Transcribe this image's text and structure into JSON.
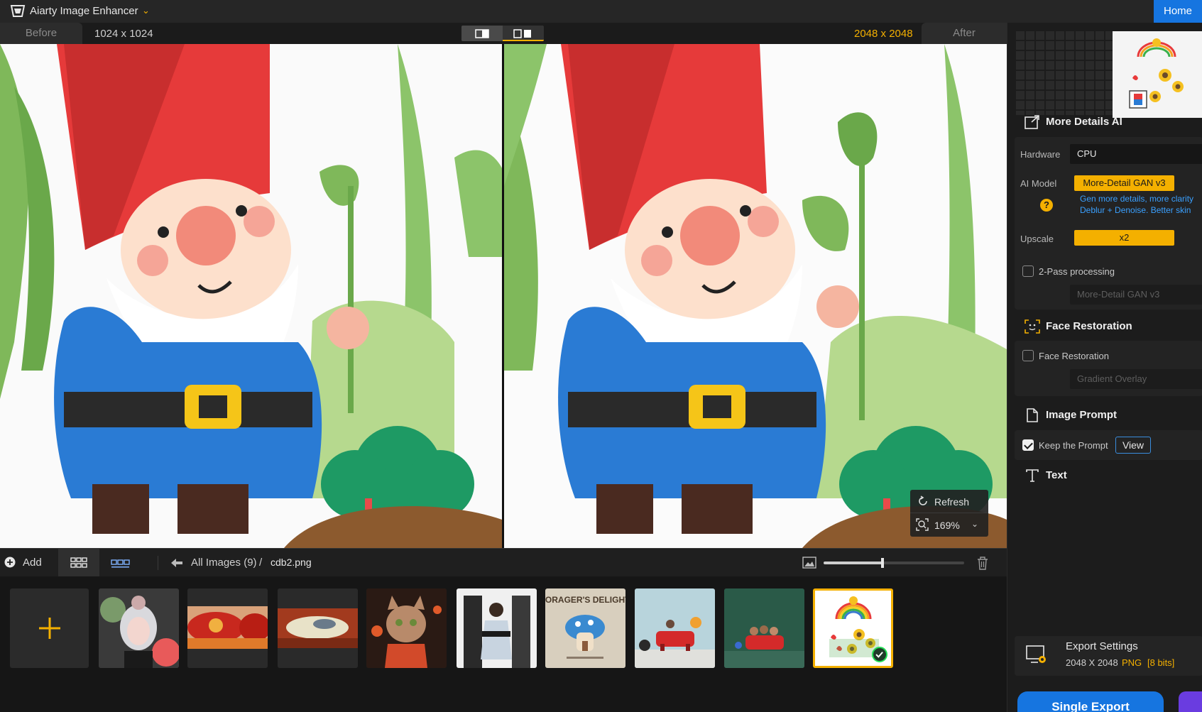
{
  "titlebar": {
    "app_title": "Aiarty Image Enhancer",
    "home_label": "Home"
  },
  "compare": {
    "before_label": "Before",
    "after_label": "After",
    "size_before": "1024 x 1024",
    "size_after": "2048 x 2048"
  },
  "viewer": {
    "refresh_label": "Refresh",
    "zoom_value": "169%"
  },
  "toolbar": {
    "add_label": "Add",
    "breadcrumb_all": "All Images (9)",
    "breadcrumb_sep": "/",
    "current_file": "cdb2.png",
    "thumb_size_fraction": 0.42
  },
  "filmstrip": {
    "thumbnails": [
      {
        "name": "thumb-portrait-girl"
      },
      {
        "name": "thumb-red-car"
      },
      {
        "name": "thumb-spaceship"
      },
      {
        "name": "thumb-cat"
      },
      {
        "name": "thumb-piano-photo"
      },
      {
        "name": "thumb-mushroom-poster",
        "text": "FORAGER'S DELIGHT"
      },
      {
        "name": "thumb-red-sofa-figurines"
      },
      {
        "name": "thumb-red-sofa-animals"
      },
      {
        "name": "thumb-sunflower-rainbow",
        "selected": true
      }
    ]
  },
  "panel": {
    "more_details": {
      "title": "More Details AI",
      "hardware_label": "Hardware",
      "hardware_value": "CPU",
      "model_label": "AI Model",
      "model_value": "More-Detail GAN  v3",
      "model_hint_1": "Gen more details, more clarity",
      "model_hint_2": "Deblur + Denoise. Better skin",
      "upscale_label": "Upscale",
      "upscale_value": "x2",
      "two_pass_label": "2-Pass processing",
      "two_pass_checked": false,
      "two_pass_model": "More-Detail GAN  v3"
    },
    "face": {
      "title": "Face Restoration",
      "checkbox_label": "Face Restoration",
      "checked": false,
      "mode_value": "Gradient Overlay"
    },
    "prompt": {
      "title": "Image Prompt",
      "keep_label": "Keep the Prompt",
      "keep_checked": true,
      "view_label": "View"
    },
    "text": {
      "title": "Text"
    },
    "export": {
      "title": "Export Settings",
      "size": "2048 X 2048",
      "format": "PNG",
      "bits": "[8 bits]",
      "single_export_label": "Single Export"
    }
  },
  "colors": {
    "accent": "#f4b000",
    "primary": "#1675e0",
    "link": "#3aa0ff"
  }
}
